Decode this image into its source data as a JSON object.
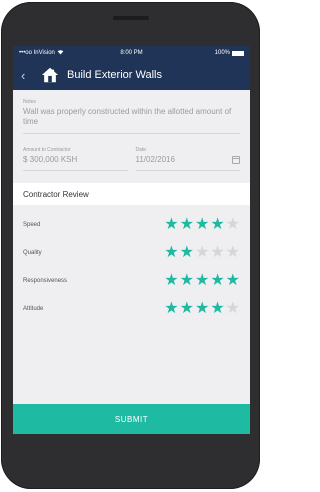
{
  "status_bar": {
    "carrier": "•••oo InVision",
    "time": "8:00 PM",
    "battery": "100%"
  },
  "nav": {
    "title": "Build Exterior Walls",
    "back_icon": "chevron-left-icon",
    "house_icon": "house-icon"
  },
  "form": {
    "notes_label": "Notes",
    "notes_value": "Wall was properly constructed within the allotted amount of time",
    "amount_label": "Amount to Contractor",
    "amount_value": "$ 300,000 KSH",
    "date_label": "Date",
    "date_value": "11/02/2016"
  },
  "review": {
    "header": "Contractor Review",
    "max_stars": 5,
    "items": [
      {
        "label": "Speed",
        "rating": 4
      },
      {
        "label": "Quality",
        "rating": 2
      },
      {
        "label": "Responsiveness",
        "rating": 5
      },
      {
        "label": "Attitude",
        "rating": 4
      }
    ]
  },
  "submit_label": "SUBMIT",
  "colors": {
    "header_bg": "#1f3456",
    "accent": "#1fbaa2",
    "star_off": "#d6d6da",
    "screen_bg": "#efeff1",
    "phone_body": "#2e2e30"
  }
}
